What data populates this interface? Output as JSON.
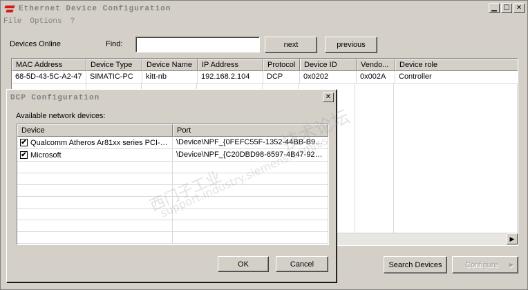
{
  "window": {
    "title": "Ethernet Device Configuration"
  },
  "menu": [
    "File",
    "Options",
    "?"
  ],
  "toolbar": {
    "devices_online_label": "Devices Online",
    "find_label": "Find:",
    "find_value": "",
    "next_label": "next",
    "previous_label": "previous"
  },
  "devices_table": {
    "columns": [
      "MAC Address",
      "Device Type",
      "Device Name",
      "IP Address",
      "Protocol",
      "Device ID",
      "Vendo...",
      "Device role"
    ],
    "rows": [
      [
        "68-5D-43-5C-A2-47",
        "SIMATIC-PC",
        "kitt-nb",
        "192.168.2.104",
        "DCP",
        "0x0202",
        "0x002A",
        "Controller"
      ]
    ]
  },
  "bottom_buttons": {
    "search_devices": "Search Devices",
    "configure": "Configure"
  },
  "dialog": {
    "title": "DCP Configuration",
    "available_label": "Available network devices:",
    "columns": [
      "Device",
      "Port"
    ],
    "rows": [
      {
        "checked": "✔",
        "device": "Qualcomm Atheros Ar81xx series PCI-E...",
        "port": "\\Device\\NPF_{0FEFC55F-1352-44BB-B98..."
      },
      {
        "checked": "✔",
        "device": "Microsoft",
        "port": "\\Device\\NPF_{C20DBD98-6597-4B47-929..."
      }
    ],
    "ok_label": "OK",
    "cancel_label": "Cancel"
  },
  "watermark": [
    "西门子工业",
    "support.industry.siemens.com/cs",
    "技术论坛"
  ]
}
